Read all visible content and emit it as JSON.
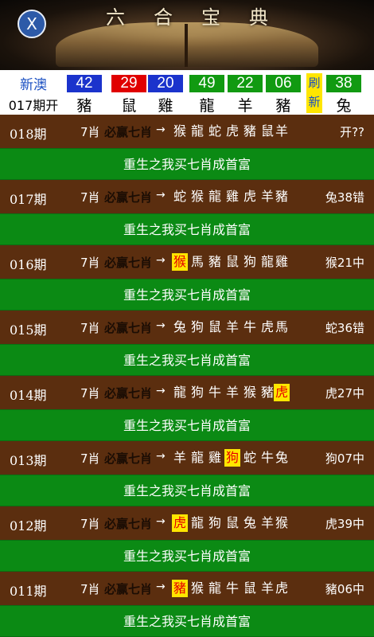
{
  "header": {
    "title": "六合宝典",
    "close_label": "X"
  },
  "result": {
    "source": "新澳",
    "period": "017期开",
    "refresh_label": "刷新",
    "balls": [
      {
        "number": "42",
        "zodiac": "豬",
        "color": "#1b33cc"
      },
      {
        "number": "29",
        "zodiac": "鼠",
        "color": "#e00000"
      },
      {
        "number": "20",
        "zodiac": "雞",
        "color": "#1b33cc"
      },
      {
        "number": "49",
        "zodiac": "龍",
        "color": "#119a11"
      },
      {
        "number": "22",
        "zodiac": "羊",
        "color": "#119a11"
      },
      {
        "number": "06",
        "zodiac": "豬",
        "color": "#119a11"
      },
      {
        "number": "38",
        "zodiac": "兔",
        "color": "#119a11"
      }
    ]
  },
  "predictions": [
    {
      "issue": "018期",
      "count": "7肖",
      "tag": "必赢七肖",
      "picks": [
        "猴",
        "龍",
        "蛇",
        "虎",
        "豬",
        "鼠",
        "羊"
      ],
      "hit_index": -1,
      "result": "开??",
      "slogan": "重生之我买七肖成首富"
    },
    {
      "issue": "017期",
      "count": "7肖",
      "tag": "必赢七肖",
      "picks": [
        "蛇",
        "猴",
        "龍",
        "雞",
        "虎",
        "羊",
        "豬"
      ],
      "hit_index": -1,
      "result": "兔38错",
      "slogan": "重生之我买七肖成首富"
    },
    {
      "issue": "016期",
      "count": "7肖",
      "tag": "必赢七肖",
      "picks": [
        "猴",
        "馬",
        "豬",
        "鼠",
        "狗",
        "龍",
        "雞"
      ],
      "hit_index": 0,
      "result": "猴21中",
      "slogan": "重生之我买七肖成首富"
    },
    {
      "issue": "015期",
      "count": "7肖",
      "tag": "必赢七肖",
      "picks": [
        "兔",
        "狗",
        "鼠",
        "羊",
        "牛",
        "虎",
        "馬"
      ],
      "hit_index": -1,
      "result": "蛇36错",
      "slogan": "重生之我买七肖成首富"
    },
    {
      "issue": "014期",
      "count": "7肖",
      "tag": "必赢七肖",
      "picks": [
        "龍",
        "狗",
        "牛",
        "羊",
        "猴",
        "豬",
        "虎"
      ],
      "hit_index": 6,
      "result": "虎27中",
      "slogan": "重生之我买七肖成首富"
    },
    {
      "issue": "013期",
      "count": "7肖",
      "tag": "必赢七肖",
      "picks": [
        "羊",
        "龍",
        "雞",
        "狗",
        "蛇",
        "牛",
        "兔"
      ],
      "hit_index": 3,
      "result": "狗07中",
      "slogan": "重生之我买七肖成首富"
    },
    {
      "issue": "012期",
      "count": "7肖",
      "tag": "必赢七肖",
      "picks": [
        "虎",
        "龍",
        "狗",
        "鼠",
        "兔",
        "羊",
        "猴"
      ],
      "hit_index": 0,
      "result": "虎39中",
      "slogan": "重生之我买七肖成首富"
    },
    {
      "issue": "011期",
      "count": "7肖",
      "tag": "必赢七肖",
      "picks": [
        "豬",
        "猴",
        "龍",
        "牛",
        "鼠",
        "羊",
        "虎"
      ],
      "hit_index": 0,
      "result": "豬06中",
      "slogan": "重生之我买七肖成首富"
    }
  ],
  "arrow_glyph": "→"
}
